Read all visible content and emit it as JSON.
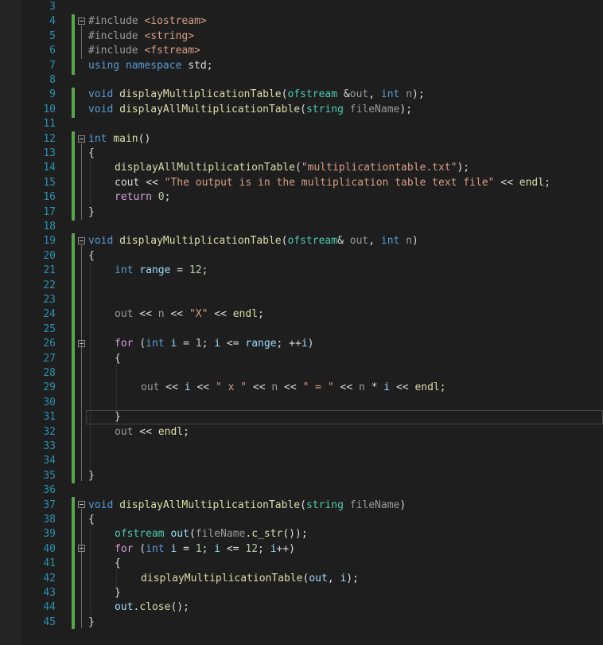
{
  "editor": {
    "line_numbers": [
      "3",
      "4",
      "5",
      "6",
      "7",
      "8",
      "9",
      "10",
      "11",
      "12",
      "13",
      "14",
      "15",
      "16",
      "17",
      "18",
      "19",
      "20",
      "21",
      "22",
      "23",
      "24",
      "25",
      "26",
      "27",
      "28",
      "29",
      "30",
      "31",
      "32",
      "33",
      "34",
      "35",
      "36",
      "37",
      "38",
      "39",
      "40",
      "41",
      "42",
      "43",
      "44",
      "45"
    ],
    "code": {
      "l4": [
        "#include ",
        "<iostream>"
      ],
      "l5": [
        "#include ",
        "<string>"
      ],
      "l6": [
        "#include ",
        "<fstream>"
      ],
      "l7": [
        "using",
        " ",
        "namespace",
        " std;"
      ],
      "l9": [
        "void",
        " ",
        "displayMultiplicationTable",
        "(",
        "ofstream",
        " &",
        "out",
        ", ",
        "int",
        " ",
        "n",
        ");"
      ],
      "l10": [
        "void",
        " ",
        "displayAllMultiplicationTable",
        "(",
        "string",
        " ",
        "fileName",
        ");"
      ],
      "l12": [
        "int",
        " ",
        "main",
        "()"
      ],
      "l13": [
        "{"
      ],
      "l14": [
        "displayAllMultiplicationTable",
        "(",
        "\"multiplicationtable.txt\"",
        ");"
      ],
      "l15": [
        "cout",
        " << ",
        "\"The output is in the multiplication table text file\"",
        " << ",
        "endl",
        ";"
      ],
      "l16": [
        "return",
        " ",
        "0",
        ";"
      ],
      "l17": [
        "}"
      ],
      "l19": [
        "void",
        " ",
        "displayMultiplicationTable",
        "(",
        "ofstream",
        "& ",
        "out",
        ", ",
        "int",
        " ",
        "n",
        ")"
      ],
      "l20": [
        "{"
      ],
      "l21": [
        "int",
        " ",
        "range",
        " = ",
        "12",
        ";"
      ],
      "l24": [
        "out",
        " << ",
        "n",
        " << ",
        "\"X\"",
        " << ",
        "endl",
        ";"
      ],
      "l26": [
        "for",
        " (",
        "int",
        " ",
        "i",
        " = ",
        "1",
        "; ",
        "i",
        " <= ",
        "range",
        "; ++",
        "i",
        ")"
      ],
      "l27": [
        "{"
      ],
      "l29": [
        "out",
        " << ",
        "i",
        " << ",
        "\" x \"",
        " << ",
        "n",
        " << ",
        "\" = \"",
        " << ",
        "n",
        " * ",
        "i",
        " << ",
        "endl",
        ";"
      ],
      "l31": [
        "}"
      ],
      "l32": [
        "out",
        " << ",
        "endl",
        ";"
      ],
      "l35": [
        "}"
      ],
      "l37": [
        "void",
        " ",
        "displayAllMultiplicationTable",
        "(",
        "string",
        " ",
        "fileName",
        ")"
      ],
      "l38": [
        "{"
      ],
      "l39": [
        "ofstream",
        " ",
        "out",
        "(",
        "fileName",
        ".",
        "c_str",
        "());"
      ],
      "l40": [
        "for",
        " (",
        "int",
        " ",
        "i",
        " = ",
        "1",
        "; ",
        "i",
        " <= ",
        "12",
        "; ",
        "i",
        "++)"
      ],
      "l41": [
        "{"
      ],
      "l42": [
        "displayMultiplicationTable",
        "(",
        "out",
        ", ",
        "i",
        ");"
      ],
      "l43": [
        "}"
      ],
      "l44": [
        "out",
        ".",
        "close",
        "();"
      ],
      "l45": [
        "}"
      ]
    },
    "colors": {
      "background": "#1e1e1e",
      "line_number": "#2b91af",
      "keyword": "#569cd6",
      "control": "#d8a0df",
      "string": "#d69d85",
      "type": "#4ec9b0",
      "function": "#dcdcaa",
      "number": "#b5cea8",
      "change_bar": "#57a64a"
    }
  }
}
